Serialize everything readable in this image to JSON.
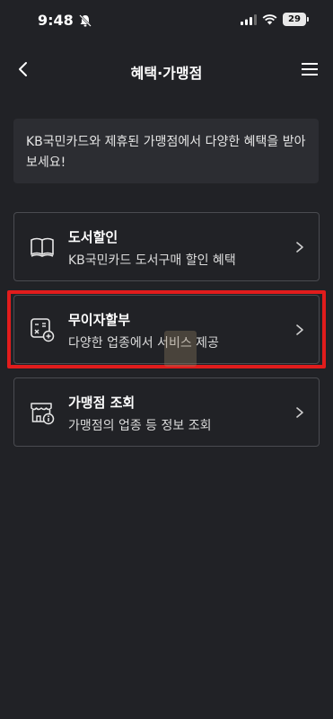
{
  "status_bar": {
    "time": "9:48",
    "battery": "29",
    "icons": [
      "bell-slash-icon",
      "signal-icon",
      "wifi-icon",
      "battery-icon"
    ]
  },
  "header": {
    "title": "혜택·가맹점",
    "back_icon": "chevron-left-icon",
    "menu_icon": "hamburger-menu-icon"
  },
  "notice": {
    "text": "KB국민카드와 제휴된 가맹점에서 다양한 혜택을 받아 보세요!"
  },
  "items": [
    {
      "icon": "book-icon",
      "title": "도서할인",
      "desc": "KB국민카드 도서구매 할인 혜택"
    },
    {
      "icon": "calculator-icon",
      "title": "무이자할부",
      "desc": "다양한 업종에서 서비스 제공"
    },
    {
      "icon": "store-icon",
      "title": "가맹점 조회",
      "desc": "가맹점의 업종 등 정보 조회"
    }
  ],
  "colors": {
    "background": "#212226",
    "card_border": "#4a4b50",
    "notice_bg": "#2c2d32",
    "highlight": "#e11c1c"
  }
}
